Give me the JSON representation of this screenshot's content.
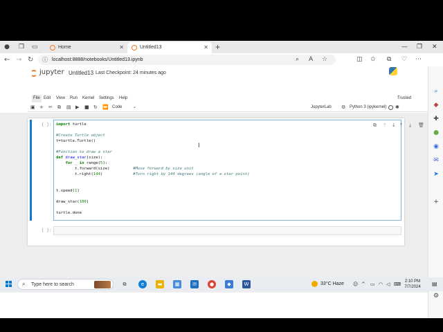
{
  "browser": {
    "tabs": [
      {
        "label": "Home"
      },
      {
        "label": "Untitled13"
      }
    ],
    "address": "localhost:8888/notebooks/Untitled13.ipynb"
  },
  "jupyter": {
    "logo_text": "jupyter",
    "notebook_title": "Untitled13",
    "checkpoint": "Last Checkpoint: 24 minutes ago",
    "trusted": "Trusted",
    "menu": [
      "File",
      "Edit",
      "View",
      "Run",
      "Kernel",
      "Settings",
      "Help"
    ],
    "cell_type": "Code",
    "jupyterlab_label": "JupyterLab",
    "kernel_label": "Python 3 (ipykernel)"
  },
  "cells": [
    {
      "prompt": "[ ]:",
      "lines": [
        "import turtle",
        "",
        "#Create Turtle object",
        "t=turtle.Turtle()",
        "",
        "#Function to draw a star",
        "def draw_star(size):",
        "    for _ in range(5):",
        "        t.forward(size)          #Move forward by size unit",
        "        t.right(144)             #Turn right by 144 degrees (angle of a star point)",
        "",
        "",
        "t.speed(1)",
        "",
        "draw_star(100)",
        "",
        "turtle.done"
      ]
    },
    {
      "prompt": "[ ]:"
    }
  ],
  "taskbar": {
    "search_placeholder": "Type here to search",
    "weather": "33°C  Haze",
    "time": "2:10 PM",
    "date": "7/7/2024"
  },
  "colors": {
    "accent_cell": "#1976d2",
    "jupyter_orange": "#f37726",
    "windows_blue": "#0078d4"
  }
}
